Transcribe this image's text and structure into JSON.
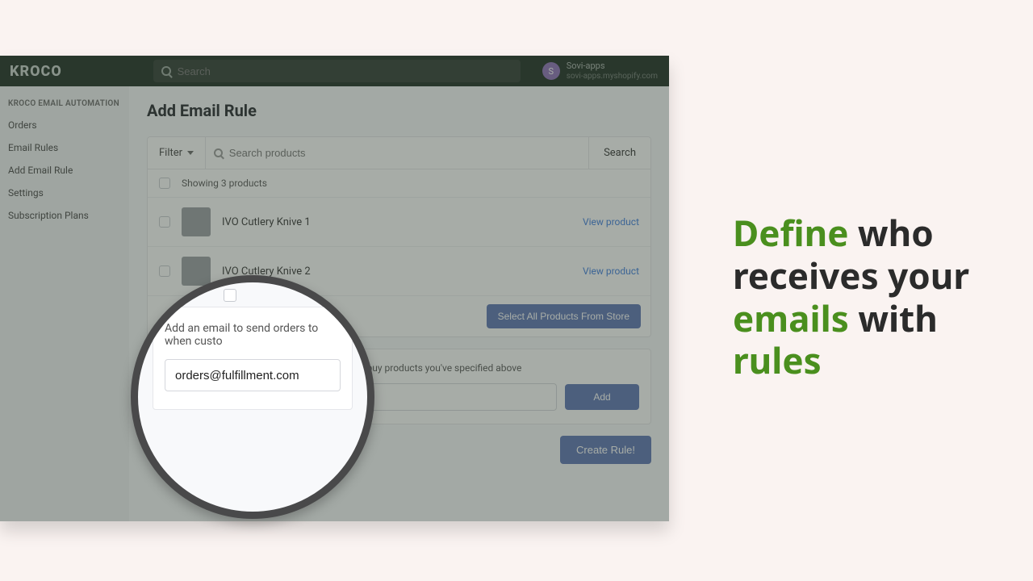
{
  "topbar": {
    "logo": "KROCO",
    "search_placeholder": "Search",
    "user_name": "Sovi-apps",
    "user_domain": "sovi-apps.myshopify.com",
    "avatar_letter": "S"
  },
  "sidebar": {
    "heading": "KROCO EMAIL AUTOMATION",
    "items": [
      {
        "label": "Orders"
      },
      {
        "label": "Email Rules"
      },
      {
        "label": "Add Email Rule"
      },
      {
        "label": "Settings"
      },
      {
        "label": "Subscription Plans"
      }
    ]
  },
  "page": {
    "title": "Add Email Rule"
  },
  "filter": {
    "label": "Filter",
    "search_placeholder": "Search products",
    "search_button": "Search"
  },
  "products": {
    "showing": "Showing 3 products",
    "items": [
      {
        "name": "IVO Cutlery Knive 1",
        "view": "View product"
      },
      {
        "name": "IVO Cutlery Knive 2",
        "view": "View product"
      }
    ],
    "select_all": "Select All Products From Store"
  },
  "email_section": {
    "desc_full": "Add an email to send orders to when customers buy products you've specified above",
    "desc_truncated": "Add an email to send orders to when custo",
    "input_value": "orders@fulfillment.com",
    "add_button": "Add"
  },
  "actions": {
    "create": "Create Rule!"
  },
  "headline": {
    "w1": "Define",
    "w2": " who receives your ",
    "w3": "emails",
    "w4": " with ",
    "w5": "rules"
  }
}
